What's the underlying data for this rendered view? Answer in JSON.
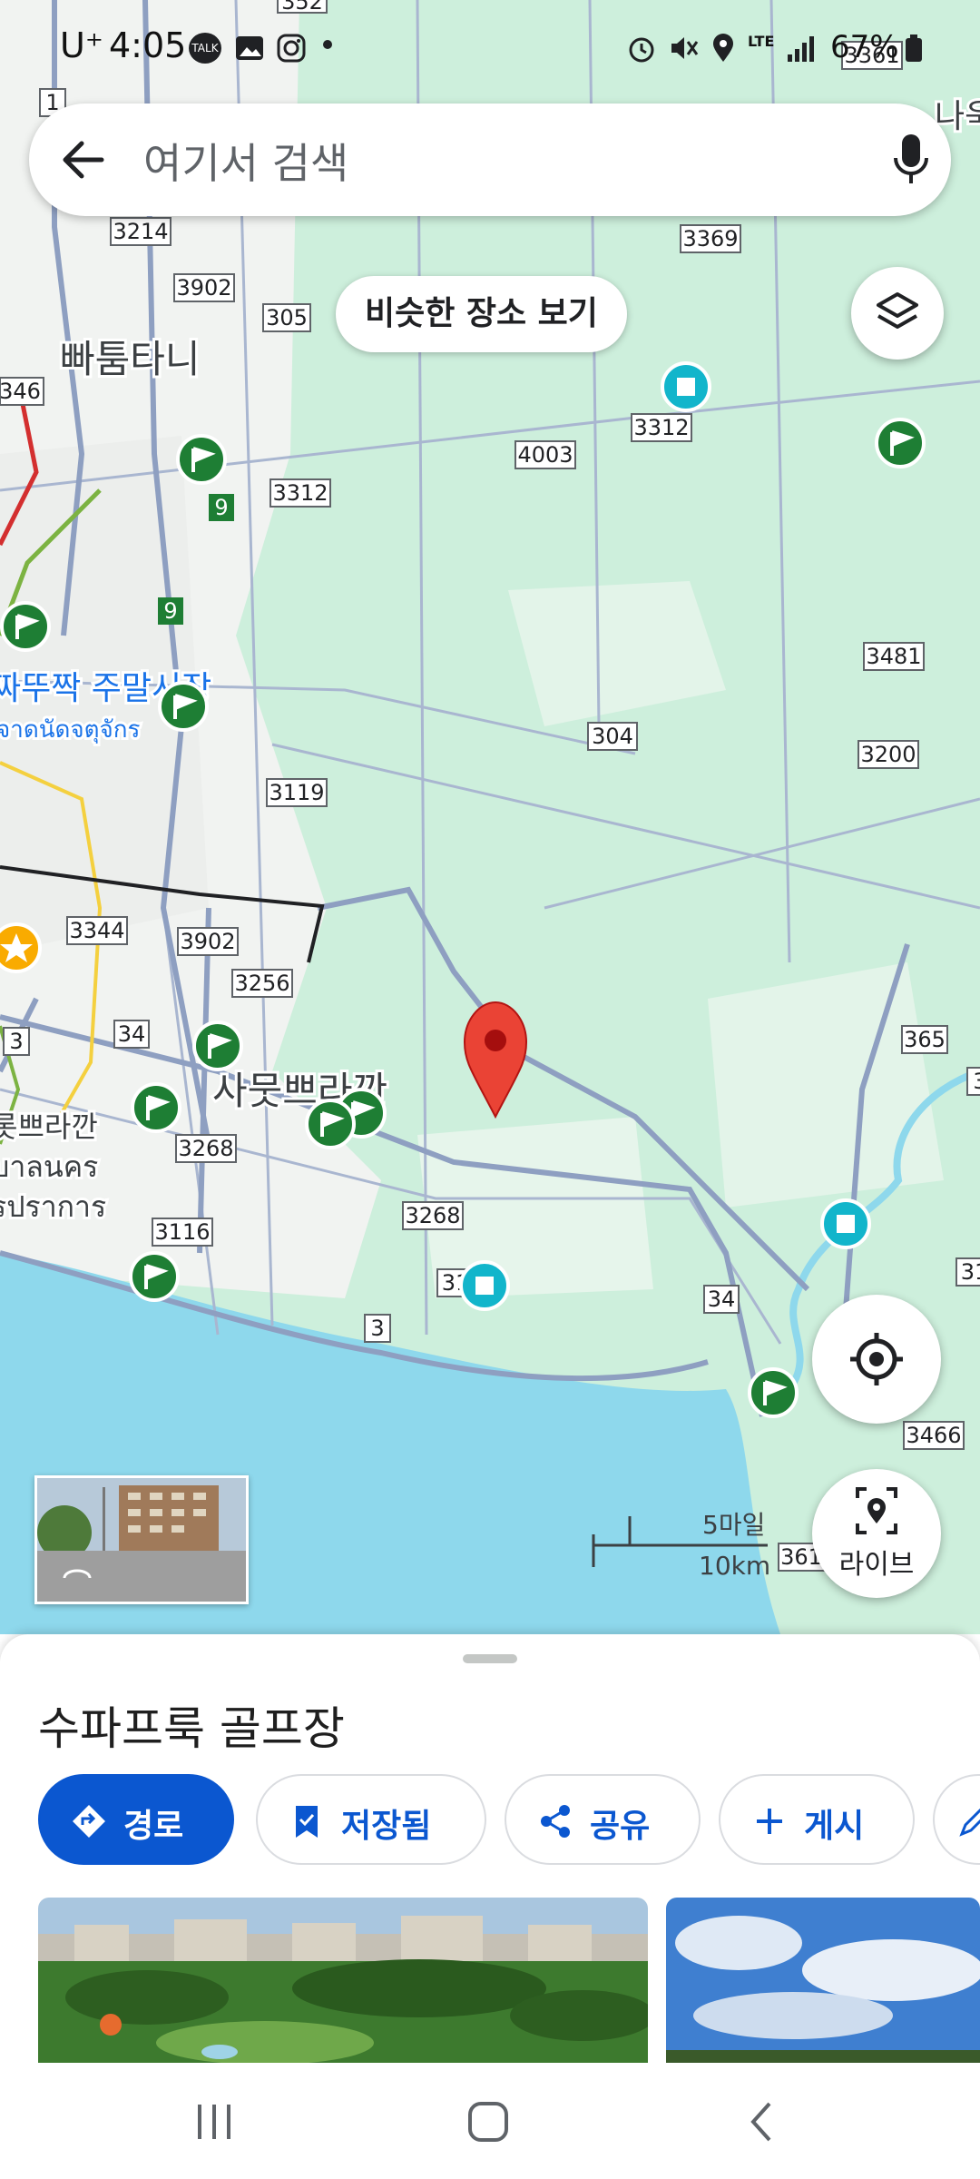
{
  "status_bar": {
    "carrier": "U⁺",
    "time": "4:05",
    "talk_badge": "TALK",
    "network": "LTE",
    "battery": "67%"
  },
  "search": {
    "placeholder": "여기서 검색"
  },
  "map": {
    "similar_places_button": "비슷한 장소 보기",
    "labels": {
      "pathum_thani": "빠툼타니",
      "chatuchak": "짜뚜짝 주말시장",
      "chatuchak_thai": "จาดนัดจตุจักร",
      "samut_prakan": "사뭇쁘라깐",
      "samut_prakan_left": "롯쁘라깐",
      "nakhon_thai": "บาลนคร",
      "prakan_thai": "รปราการ",
      "top_right": "나욱"
    },
    "road_numbers": [
      "352",
      "1",
      "3214",
      "3902",
      "305",
      "3369",
      "346",
      "3312",
      "4003",
      "9",
      "3312",
      "9",
      "3481",
      "304",
      "3200",
      "3119",
      "3344",
      "3902",
      "3256",
      "34",
      "3",
      "365",
      "3268",
      "3268",
      "3116",
      "34",
      "3",
      "3466",
      "3",
      "361",
      "31",
      "31",
      "3361"
    ],
    "scale": {
      "miles": "5마일",
      "km": "10km"
    },
    "live_label": "라이브"
  },
  "sheet": {
    "place_name": "수파프룩 골프장",
    "chips": [
      {
        "label": "경로",
        "icon": "directions-icon"
      },
      {
        "label": "저장됨",
        "icon": "bookmark-icon"
      },
      {
        "label": "공유",
        "icon": "share-icon"
      },
      {
        "label": "게시",
        "icon": "plus-icon"
      }
    ]
  },
  "colors": {
    "map_green": "#cdefdc",
    "water": "#8ed8ec",
    "road": "#8e9fc1",
    "pin_red": "#ea4335",
    "accent_blue": "#0b57d0",
    "flag_green": "#1e7e34",
    "poi_teal": "#12b5cb"
  }
}
